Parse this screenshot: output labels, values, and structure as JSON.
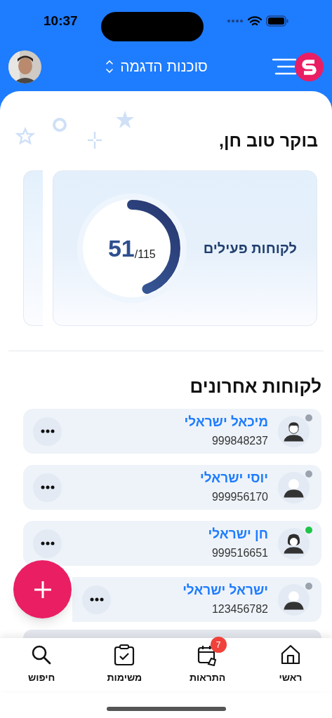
{
  "status_bar": {
    "time": "10:37"
  },
  "header": {
    "agency": "סוכנות הדגמה"
  },
  "greeting": "בוקר טוב חן,",
  "stat_card": {
    "label": "לקוחות פעילים",
    "value": "51",
    "total": "/115",
    "level": 0.443
  },
  "recent": {
    "title": "לקוחות אחרונים",
    "customers": [
      {
        "name": "מיכאל ישראלי",
        "id": "999848237",
        "online": false,
        "kind": "man"
      },
      {
        "name": "יוסי ישראלי",
        "id": "999956170",
        "online": false,
        "kind": "person"
      },
      {
        "name": "חן ישראלי",
        "id": "999516651",
        "online": true,
        "kind": "woman"
      },
      {
        "name": "ישראל ישראלי",
        "id": "123456782",
        "online": false,
        "kind": "person"
      }
    ]
  },
  "bottom_nav": [
    {
      "label": "ראשי",
      "kind": "home"
    },
    {
      "label": "התראות",
      "kind": "alerts",
      "badge": "7"
    },
    {
      "label": "משימות",
      "kind": "tasks"
    },
    {
      "label": "חיפוש",
      "kind": "search"
    }
  ]
}
